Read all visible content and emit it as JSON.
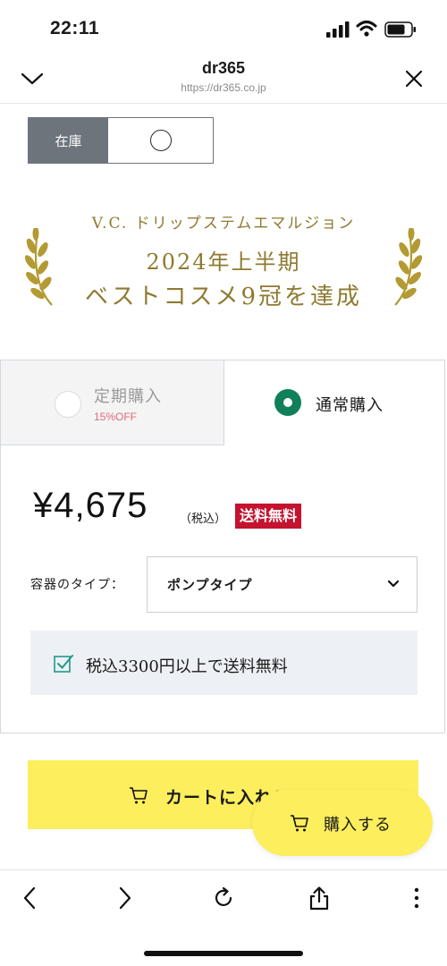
{
  "status_bar": {
    "time": "22:11",
    "icons": [
      "signal-icon",
      "wifi-icon",
      "battery-icon"
    ]
  },
  "browser": {
    "title": "dr365",
    "url": "https://dr365.co.jp",
    "left_icon": "chevron-down-icon",
    "right_icon": "close-icon"
  },
  "stock": {
    "label": "在庫",
    "value_icon": "circle-icon"
  },
  "award": {
    "line1": "V.C. ドリップステムエマルジョン",
    "line2": "2024年上半期",
    "line3": "ベストコスメ9冠を達成",
    "color": "#8e7a30",
    "icons": [
      "laurel-left-icon",
      "laurel-right-icon"
    ]
  },
  "purchase": {
    "tabs": [
      {
        "label": "定期購入",
        "sub": "15%OFF",
        "selected": false
      },
      {
        "label": "通常購入",
        "selected": true
      }
    ],
    "price": "¥4,675",
    "tax_note": "（税込）",
    "free_shipping_badge": "送料無料",
    "container_label": "容器のタイプ：",
    "container_selected": "ポンプタイプ",
    "shipping_note": "税込3300円以上で送料無料",
    "accent_color": "#11805a",
    "badge_color": "#c4122f"
  },
  "actions": {
    "cart_label": "カートに入れる",
    "buy_label": "購入する",
    "button_color": "#fcee5c"
  },
  "toolbar": {
    "icons": [
      "back-icon",
      "forward-icon",
      "reload-icon",
      "share-icon",
      "more-icon"
    ]
  }
}
